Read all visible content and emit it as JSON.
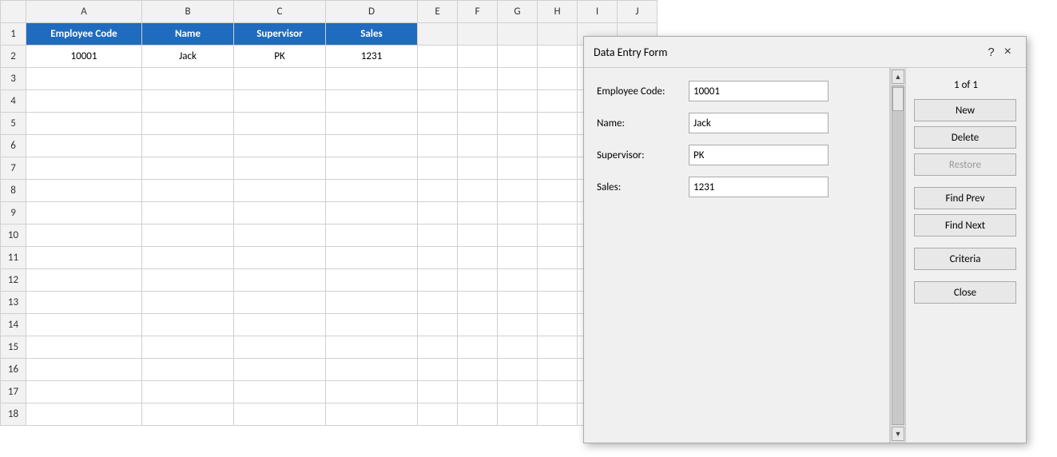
{
  "spreadsheet": {
    "col_headers": [
      "",
      "A",
      "B",
      "C",
      "D",
      "E",
      "F",
      "G",
      "H",
      "I",
      "J"
    ],
    "row_headers": [
      "1",
      "2",
      "3",
      "4",
      "5",
      "6",
      "7",
      "8",
      "9",
      "10",
      "11",
      "12",
      "13",
      "14",
      "15",
      "16",
      "17",
      "18"
    ],
    "header_row": {
      "employee_code": "Employee Code",
      "name": "Name",
      "supervisor": "Supervisor",
      "sales": "Sales"
    },
    "data_rows": [
      {
        "row": "2",
        "a": "10001",
        "b": "Jack",
        "c": "PK",
        "d": "1231"
      },
      {
        "row": "3",
        "a": "",
        "b": "",
        "c": "",
        "d": ""
      },
      {
        "row": "4",
        "a": "",
        "b": "",
        "c": "",
        "d": ""
      },
      {
        "row": "5",
        "a": "",
        "b": "",
        "c": "",
        "d": ""
      },
      {
        "row": "6",
        "a": "",
        "b": "",
        "c": "",
        "d": ""
      },
      {
        "row": "7",
        "a": "",
        "b": "",
        "c": "",
        "d": ""
      },
      {
        "row": "8",
        "a": "",
        "b": "",
        "c": "",
        "d": ""
      },
      {
        "row": "9",
        "a": "",
        "b": "",
        "c": "",
        "d": ""
      },
      {
        "row": "10",
        "a": "",
        "b": "",
        "c": "",
        "d": ""
      },
      {
        "row": "11",
        "a": "",
        "b": "",
        "c": "",
        "d": ""
      },
      {
        "row": "12",
        "a": "",
        "b": "",
        "c": "",
        "d": ""
      },
      {
        "row": "13",
        "a": "",
        "b": "",
        "c": "",
        "d": ""
      },
      {
        "row": "14",
        "a": "",
        "b": "",
        "c": "",
        "d": ""
      },
      {
        "row": "15",
        "a": "",
        "b": "",
        "c": "",
        "d": ""
      },
      {
        "row": "16",
        "a": "",
        "b": "",
        "c": "",
        "d": ""
      },
      {
        "row": "17",
        "a": "",
        "b": "",
        "c": "",
        "d": ""
      },
      {
        "row": "18",
        "a": "",
        "b": "",
        "c": "",
        "d": ""
      }
    ]
  },
  "dialog": {
    "title": "Data Entry Form",
    "help_label": "?",
    "close_label": "×",
    "record_info": "1 of 1",
    "fields": {
      "employee_code": {
        "label": "Employee Code:",
        "value": "10001"
      },
      "name": {
        "label": "Name:",
        "value": "Jack"
      },
      "supervisor": {
        "label": "Supervisor:",
        "value": "PK"
      },
      "sales": {
        "label": "Sales:",
        "value": "1231"
      }
    },
    "buttons": {
      "new": "New",
      "delete": "Delete",
      "restore": "Restore",
      "find_prev": "Find Prev",
      "find_next": "Find Next",
      "criteria": "Criteria",
      "close": "Close"
    }
  }
}
